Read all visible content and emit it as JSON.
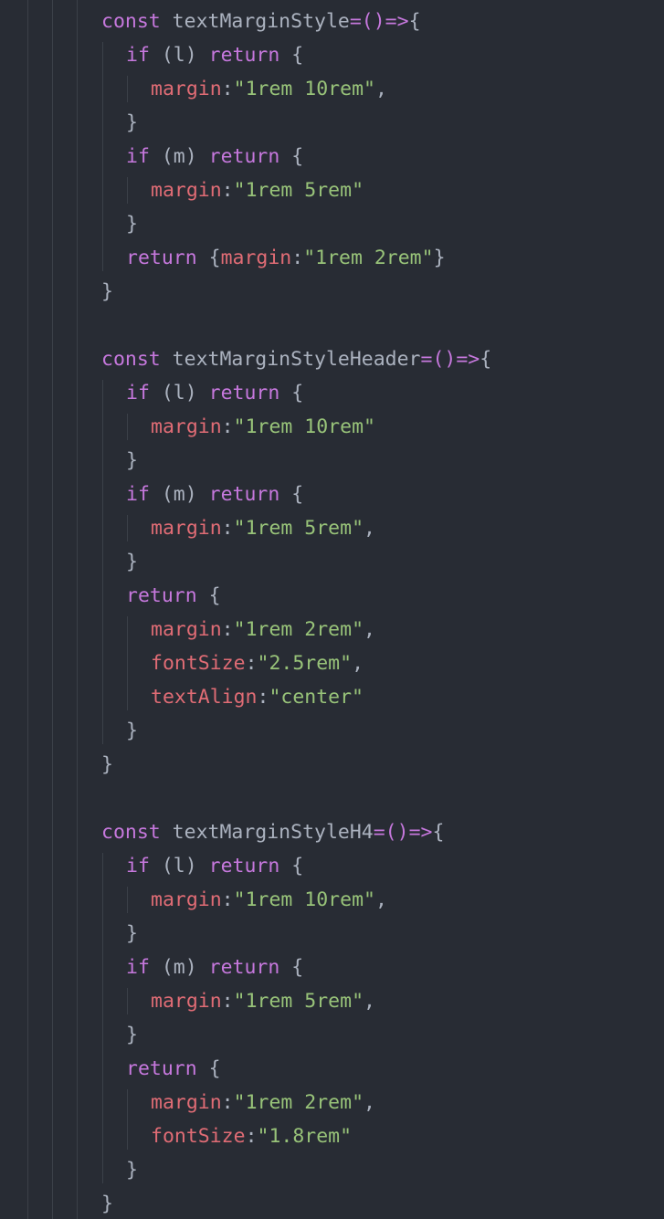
{
  "editor": {
    "theme": "one-dark",
    "colors": {
      "background": "#282c34",
      "keyword": "#c678dd",
      "property": "#e06c75",
      "string": "#98c379",
      "punctuation": "#abb2bf",
      "indent_guide": "#3b4048"
    },
    "lines": [
      {
        "indent": 0,
        "tokens": [
          {
            "t": "kw",
            "v": "const"
          },
          {
            "t": "ident",
            "v": " textMarginStyle"
          },
          {
            "t": "op",
            "v": "=()=>"
          },
          {
            "t": "punc",
            "v": "{"
          }
        ]
      },
      {
        "indent": 1,
        "tokens": [
          {
            "t": "kw",
            "v": "if"
          },
          {
            "t": "punc",
            "v": " (l) "
          },
          {
            "t": "kw",
            "v": "return"
          },
          {
            "t": "punc",
            "v": " {"
          }
        ]
      },
      {
        "indent": 2,
        "tokens": [
          {
            "t": "prop",
            "v": "margin"
          },
          {
            "t": "punc",
            "v": ":"
          },
          {
            "t": "str",
            "v": "\"1rem 10rem\""
          },
          {
            "t": "punc",
            "v": ","
          }
        ]
      },
      {
        "indent": 1,
        "tokens": [
          {
            "t": "punc",
            "v": "}"
          }
        ]
      },
      {
        "indent": 1,
        "tokens": [
          {
            "t": "kw",
            "v": "if"
          },
          {
            "t": "punc",
            "v": " (m) "
          },
          {
            "t": "kw",
            "v": "return"
          },
          {
            "t": "punc",
            "v": " {"
          }
        ]
      },
      {
        "indent": 2,
        "tokens": [
          {
            "t": "prop",
            "v": "margin"
          },
          {
            "t": "punc",
            "v": ":"
          },
          {
            "t": "str",
            "v": "\"1rem 5rem\""
          }
        ]
      },
      {
        "indent": 1,
        "tokens": [
          {
            "t": "punc",
            "v": "}"
          }
        ]
      },
      {
        "indent": 1,
        "tokens": [
          {
            "t": "kw",
            "v": "return"
          },
          {
            "t": "punc",
            "v": " {"
          },
          {
            "t": "prop",
            "v": "margin"
          },
          {
            "t": "punc",
            "v": ":"
          },
          {
            "t": "str",
            "v": "\"1rem 2rem\""
          },
          {
            "t": "punc",
            "v": "}"
          }
        ]
      },
      {
        "indent": 0,
        "tokens": [
          {
            "t": "punc",
            "v": "}"
          }
        ]
      },
      {
        "indent": 0,
        "tokens": []
      },
      {
        "indent": 0,
        "tokens": [
          {
            "t": "kw",
            "v": "const"
          },
          {
            "t": "ident",
            "v": " textMarginStyleHeader"
          },
          {
            "t": "op",
            "v": "=()=>"
          },
          {
            "t": "punc",
            "v": "{"
          }
        ]
      },
      {
        "indent": 1,
        "tokens": [
          {
            "t": "kw",
            "v": "if"
          },
          {
            "t": "punc",
            "v": " (l) "
          },
          {
            "t": "kw",
            "v": "return"
          },
          {
            "t": "punc",
            "v": " {"
          }
        ]
      },
      {
        "indent": 2,
        "tokens": [
          {
            "t": "prop",
            "v": "margin"
          },
          {
            "t": "punc",
            "v": ":"
          },
          {
            "t": "str",
            "v": "\"1rem 10rem\""
          }
        ]
      },
      {
        "indent": 1,
        "tokens": [
          {
            "t": "punc",
            "v": "}"
          }
        ]
      },
      {
        "indent": 1,
        "tokens": [
          {
            "t": "kw",
            "v": "if"
          },
          {
            "t": "punc",
            "v": " (m) "
          },
          {
            "t": "kw",
            "v": "return"
          },
          {
            "t": "punc",
            "v": " {"
          }
        ]
      },
      {
        "indent": 2,
        "tokens": [
          {
            "t": "prop",
            "v": "margin"
          },
          {
            "t": "punc",
            "v": ":"
          },
          {
            "t": "str",
            "v": "\"1rem 5rem\""
          },
          {
            "t": "punc",
            "v": ","
          }
        ]
      },
      {
        "indent": 1,
        "tokens": [
          {
            "t": "punc",
            "v": "}"
          }
        ]
      },
      {
        "indent": 1,
        "tokens": [
          {
            "t": "kw",
            "v": "return"
          },
          {
            "t": "punc",
            "v": " {"
          }
        ]
      },
      {
        "indent": 2,
        "tokens": [
          {
            "t": "prop",
            "v": "margin"
          },
          {
            "t": "punc",
            "v": ":"
          },
          {
            "t": "str",
            "v": "\"1rem 2rem\""
          },
          {
            "t": "punc",
            "v": ","
          }
        ]
      },
      {
        "indent": 2,
        "tokens": [
          {
            "t": "prop",
            "v": "fontSize"
          },
          {
            "t": "punc",
            "v": ":"
          },
          {
            "t": "str",
            "v": "\"2.5rem\""
          },
          {
            "t": "punc",
            "v": ","
          }
        ]
      },
      {
        "indent": 2,
        "tokens": [
          {
            "t": "prop",
            "v": "textAlign"
          },
          {
            "t": "punc",
            "v": ":"
          },
          {
            "t": "str",
            "v": "\"center\""
          }
        ]
      },
      {
        "indent": 1,
        "tokens": [
          {
            "t": "punc",
            "v": "}"
          }
        ]
      },
      {
        "indent": 0,
        "tokens": [
          {
            "t": "punc",
            "v": "}"
          }
        ]
      },
      {
        "indent": 0,
        "tokens": []
      },
      {
        "indent": 0,
        "tokens": [
          {
            "t": "kw",
            "v": "const"
          },
          {
            "t": "ident",
            "v": " textMarginStyleH4"
          },
          {
            "t": "op",
            "v": "=()=>"
          },
          {
            "t": "punc",
            "v": "{"
          }
        ]
      },
      {
        "indent": 1,
        "tokens": [
          {
            "t": "kw",
            "v": "if"
          },
          {
            "t": "punc",
            "v": " (l) "
          },
          {
            "t": "kw",
            "v": "return"
          },
          {
            "t": "punc",
            "v": " {"
          }
        ]
      },
      {
        "indent": 2,
        "tokens": [
          {
            "t": "prop",
            "v": "margin"
          },
          {
            "t": "punc",
            "v": ":"
          },
          {
            "t": "str",
            "v": "\"1rem 10rem\""
          },
          {
            "t": "punc",
            "v": ","
          }
        ]
      },
      {
        "indent": 1,
        "tokens": [
          {
            "t": "punc",
            "v": "}"
          }
        ]
      },
      {
        "indent": 1,
        "tokens": [
          {
            "t": "kw",
            "v": "if"
          },
          {
            "t": "punc",
            "v": " (m) "
          },
          {
            "t": "kw",
            "v": "return"
          },
          {
            "t": "punc",
            "v": " {"
          }
        ]
      },
      {
        "indent": 2,
        "tokens": [
          {
            "t": "prop",
            "v": "margin"
          },
          {
            "t": "punc",
            "v": ":"
          },
          {
            "t": "str",
            "v": "\"1rem 5rem\""
          },
          {
            "t": "punc",
            "v": ","
          }
        ]
      },
      {
        "indent": 1,
        "tokens": [
          {
            "t": "punc",
            "v": "}"
          }
        ]
      },
      {
        "indent": 1,
        "tokens": [
          {
            "t": "kw",
            "v": "return"
          },
          {
            "t": "punc",
            "v": " {"
          }
        ]
      },
      {
        "indent": 2,
        "tokens": [
          {
            "t": "prop",
            "v": "margin"
          },
          {
            "t": "punc",
            "v": ":"
          },
          {
            "t": "str",
            "v": "\"1rem 2rem\""
          },
          {
            "t": "punc",
            "v": ","
          }
        ]
      },
      {
        "indent": 2,
        "tokens": [
          {
            "t": "prop",
            "v": "fontSize"
          },
          {
            "t": "punc",
            "v": ":"
          },
          {
            "t": "str",
            "v": "\"1.8rem\""
          }
        ]
      },
      {
        "indent": 1,
        "tokens": [
          {
            "t": "punc",
            "v": "}"
          }
        ]
      },
      {
        "indent": 0,
        "tokens": [
          {
            "t": "punc",
            "v": "}"
          }
        ]
      }
    ]
  }
}
